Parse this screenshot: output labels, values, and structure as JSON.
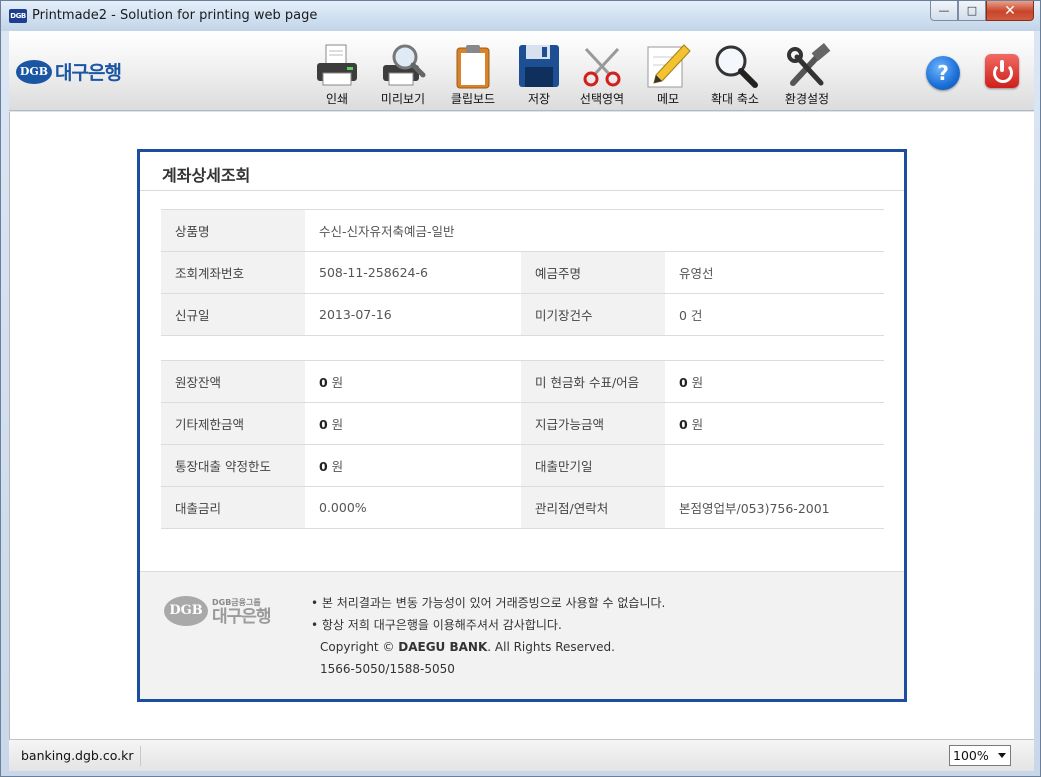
{
  "window": {
    "title": "Printmade2 - Solution for printing web page",
    "icon_text": "DGB",
    "minimize_glyph": "—",
    "maximize_glyph": "□",
    "close_glyph": "✕"
  },
  "toolbar": {
    "brand_logo_mark": "DGB",
    "brand_logo_text": "대구은행",
    "tools": [
      {
        "label": "인쇄",
        "icon": "printer-icon"
      },
      {
        "label": "미리보기",
        "icon": "print-preview-icon"
      },
      {
        "label": "클립보드",
        "icon": "clipboard-icon"
      },
      {
        "label": "저장",
        "icon": "floppy-disk-icon"
      },
      {
        "label": "선택영역",
        "icon": "scissors-icon"
      },
      {
        "label": "메모",
        "icon": "memo-pencil-icon"
      },
      {
        "label": "확대 축소",
        "icon": "magnifier-icon"
      },
      {
        "label": "환경설정",
        "icon": "tools-icon"
      }
    ],
    "help_glyph": "?"
  },
  "account": {
    "title": "계좌상세조회",
    "section1": {
      "product_label": "상품명",
      "product_value": "수신-신자유저축예금-일반",
      "account_no_label": "조회계좌번호",
      "account_no_value": "508-11-258624-6",
      "holder_label": "예금주명",
      "holder_value": "유영선",
      "open_date_label": "신규일",
      "open_date_value": "2013-07-16",
      "unposted_label": "미기장건수",
      "unposted_value": "0 건"
    },
    "section2": {
      "ledger_balance_label": "원장잔액",
      "ledger_balance_value": "0",
      "uncashed_label": "미 현금화 수표/어음",
      "uncashed_value": "0",
      "other_limit_label": "기타제한금액",
      "other_limit_value": "0",
      "payable_label": "지급가능금액",
      "payable_value": "0",
      "overdraft_label": "통장대출 약정한도",
      "overdraft_value": "0",
      "loan_maturity_label": "대출만기일",
      "loan_maturity_value": "",
      "loan_rate_label": "대출금리",
      "loan_rate_value": "0.000%",
      "branch_label": "관리점/연락처",
      "branch_value": "본점영업부/053)756-2001",
      "won_unit": " 원"
    },
    "footer": {
      "logo_mark": "DGB",
      "logo_group": "DGB금융그룹",
      "logo_bank": "대구은행",
      "notice1": "본 처리결과는 변동 가능성이 있어 거래증빙으로 사용할 수 없습니다.",
      "notice2": "항상 저희 대구은행을 이용해주셔서 감사합니다.",
      "copyright_prefix": "Copyright © ",
      "copyright_bank": "DAEGU BANK",
      "copyright_suffix": ". All Rights Reserved.",
      "phones": "1566-5050/1588-5050"
    }
  },
  "statusbar": {
    "url": "banking.dgb.co.kr",
    "zoom": "100%"
  }
}
